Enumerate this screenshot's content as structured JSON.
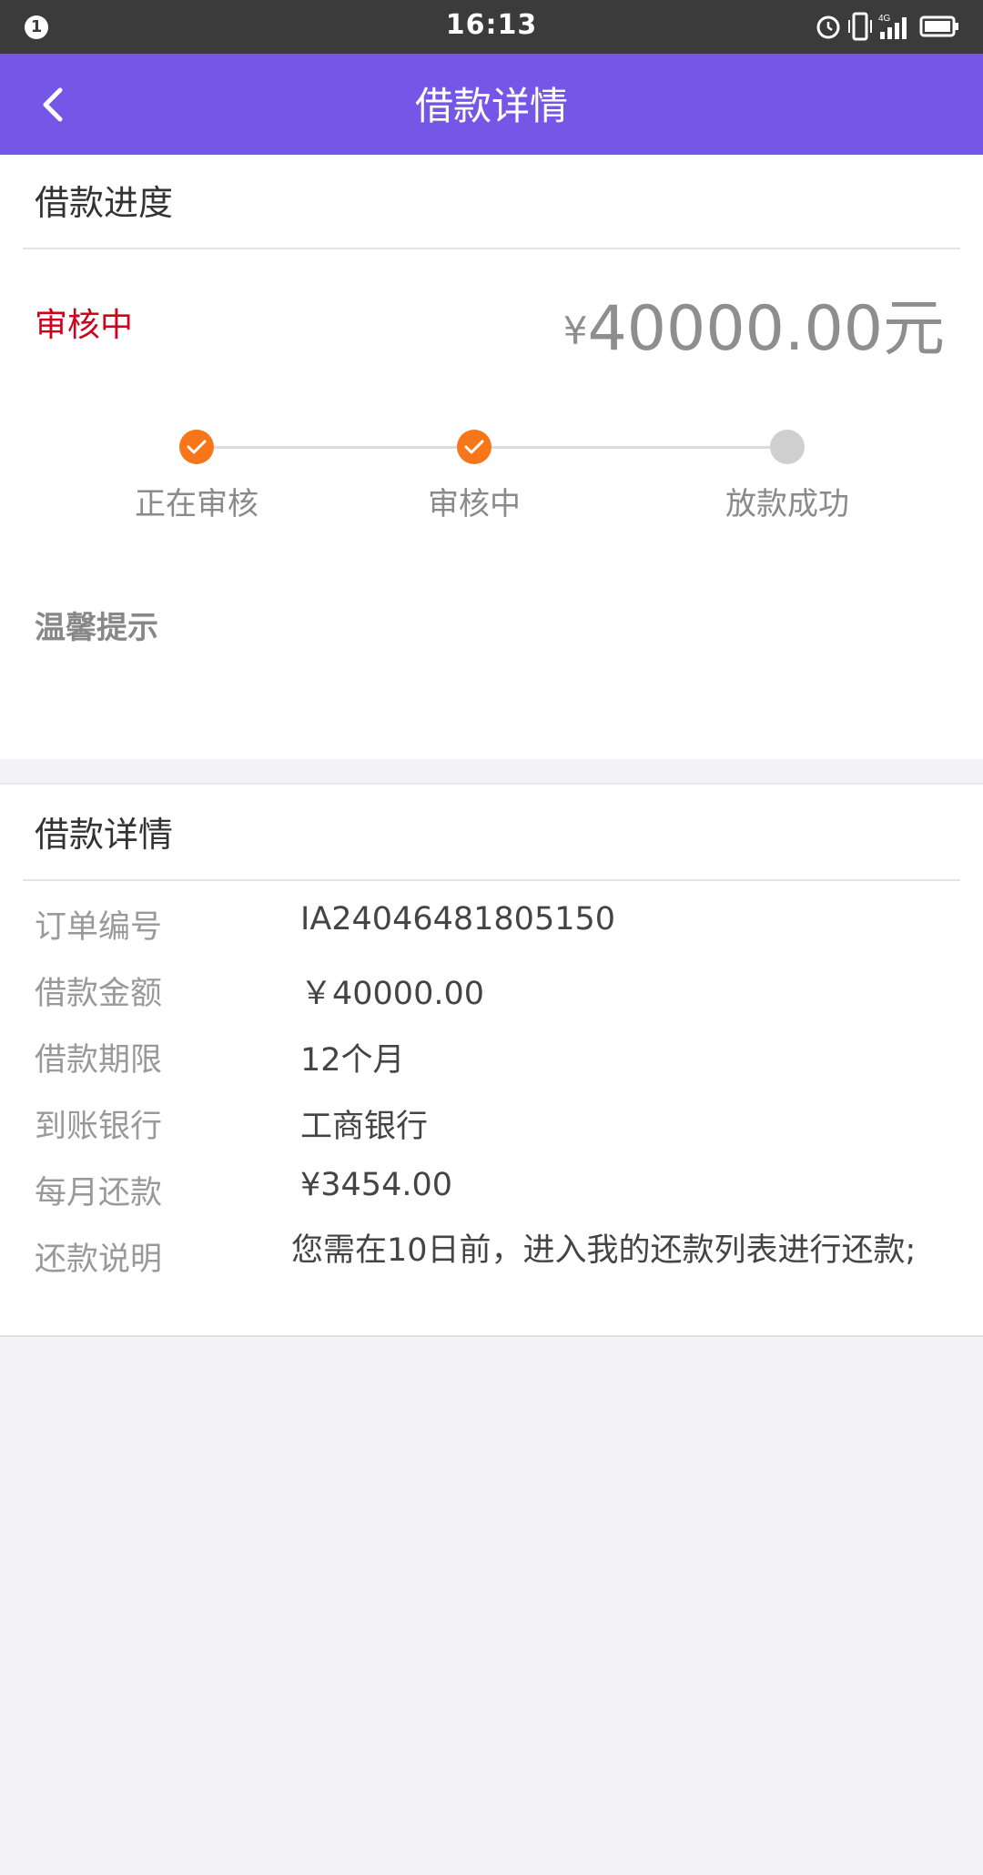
{
  "status_bar": {
    "notification_count": "1",
    "time": "16:13",
    "network": "4G"
  },
  "app_bar": {
    "title": "借款详情",
    "back_icon": "chevron-left-icon"
  },
  "progress_section": {
    "title": "借款进度",
    "status": "审核中",
    "amount_currency": "¥",
    "amount": "40000.00元",
    "steps": [
      {
        "label": "正在审核",
        "state": "done"
      },
      {
        "label": "审核中",
        "state": "done"
      },
      {
        "label": "放款成功",
        "state": "pending"
      }
    ],
    "tip_title": "温馨提示"
  },
  "detail_section": {
    "title": "借款详情",
    "rows": [
      {
        "label": "订单编号",
        "value": "IA24046481805150"
      },
      {
        "label": "借款金额",
        "value": "￥40000.00"
      },
      {
        "label": "借款期限",
        "value": "12个月"
      },
      {
        "label": "到账银行",
        "value": "工商银行"
      },
      {
        "label": "每月还款",
        "value": "¥3454.00"
      },
      {
        "label": "还款说明",
        "value": "您需在10日前，进入我的还款列表进行还款;"
      }
    ]
  },
  "colors": {
    "app_bar": "#7457e6",
    "status_red": "#d0021b",
    "step_done": "#f7761a",
    "step_pending": "#cfcfcf"
  }
}
